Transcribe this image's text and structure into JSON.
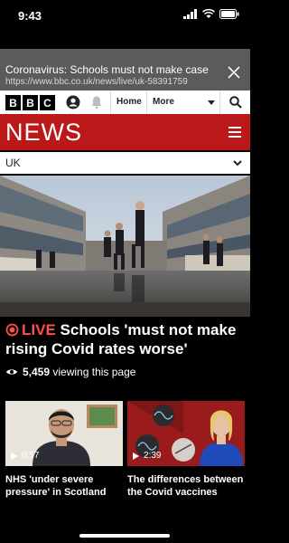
{
  "status": {
    "time": "9:43"
  },
  "browser": {
    "page_title": "Coronavirus: Schools must not make case",
    "url": "https://www.bbc.co.uk/news/live/uk-58391759"
  },
  "bbc_nav": {
    "logo_letters": [
      "B",
      "B",
      "C"
    ],
    "home_label": "Home",
    "more_label": "More"
  },
  "section": {
    "title": "NEWS",
    "region": "UK"
  },
  "article": {
    "live_label": "LIVE",
    "headline": "Schools 'must not make rising Covid rates worse'",
    "viewers_count": "5,459",
    "viewers_text": "viewing this page"
  },
  "videos": [
    {
      "duration": "0:57",
      "title": "NHS 'under severe pressure' in Scotland"
    },
    {
      "duration": "2:39",
      "title": "The differences between the Covid vaccines"
    }
  ],
  "colors": {
    "bbc_red": "#bb1919",
    "live_red": "#ff4c4c",
    "urlbar_grey": "#5b5b5b"
  }
}
